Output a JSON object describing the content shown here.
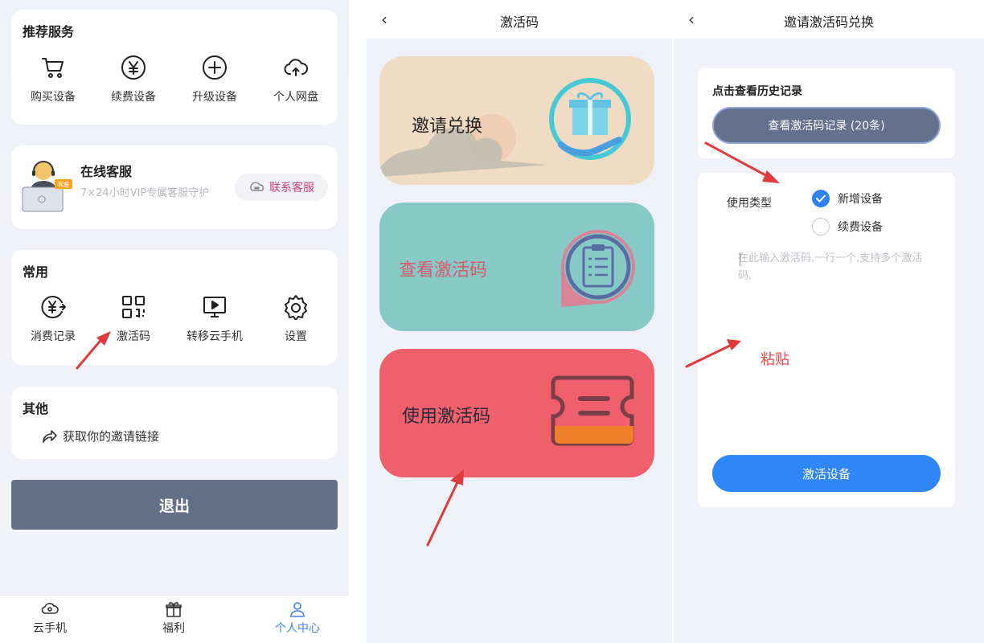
{
  "profile": {
    "recommended": {
      "title": "推荐服务",
      "items": [
        {
          "label": "购买设备",
          "icon": "cart-icon"
        },
        {
          "label": "续费设备",
          "icon": "yen-circle-icon"
        },
        {
          "label": "升级设备",
          "icon": "plus-circle-icon"
        },
        {
          "label": "个人网盘",
          "icon": "cloud-upload-icon"
        }
      ]
    },
    "support": {
      "title": "在线客服",
      "desc": "7×24小时VIP专属客服守护",
      "button": "联系客服",
      "badge": "客服"
    },
    "common": {
      "title": "常用",
      "items": [
        {
          "label": "消费记录",
          "icon": "yen-arrow-icon"
        },
        {
          "label": "激活码",
          "icon": "qr-code-icon"
        },
        {
          "label": "转移云手机",
          "icon": "monitor-play-icon"
        },
        {
          "label": "设置",
          "icon": "gear-icon"
        }
      ]
    },
    "other": {
      "title": "其他",
      "invite_link": "获取你的邀请链接"
    },
    "logout": "退出",
    "tabs": [
      {
        "label": "云手机",
        "icon": "cloud-phone-icon"
      },
      {
        "label": "福利",
        "icon": "gift-icon"
      },
      {
        "label": "个人中心",
        "icon": "person-icon",
        "active": true
      }
    ]
  },
  "activation": {
    "back": "‹",
    "title": "激活码",
    "cards": [
      {
        "label": "邀请兑换",
        "color": "#f0dcc4"
      },
      {
        "label": "查看激活码",
        "color": "#86c9c6"
      },
      {
        "label": "使用激活码",
        "color": "#ef606c"
      }
    ]
  },
  "redeem": {
    "back": "‹",
    "title": "邀请激活码兑换",
    "history": {
      "title": "点击查看历史记录",
      "button": "查看激活码记录 (20条)"
    },
    "type_label": "使用类型",
    "options": [
      {
        "label": "新增设备",
        "checked": true
      },
      {
        "label": "续费设备",
        "checked": false
      }
    ],
    "placeholder": "在此输入激活码,一行一个,支持多个激活码.",
    "paste_note": "粘贴",
    "activate_button": "激活设备"
  },
  "colors": {
    "accent": "#2f86f6",
    "logout": "#636e87",
    "arrow": "#e03a3c",
    "support_link": "#c8427e"
  }
}
